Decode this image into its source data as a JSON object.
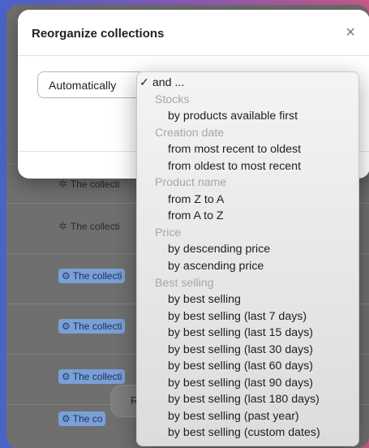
{
  "modal": {
    "title": "Reorganize collections",
    "close_glyph": "×",
    "sort_select": {
      "value": "Automatically",
      "chevron": "⇳"
    }
  },
  "background_list": {
    "rows": [
      {
        "text": "The collecti",
        "style": "plain"
      },
      {
        "text": "The collecti",
        "style": "plain"
      },
      {
        "text": "The collecti",
        "style": "chip"
      },
      {
        "text": "The collecti",
        "style": "chip"
      },
      {
        "text": "The collecti",
        "style": "chip"
      },
      {
        "text": "The co",
        "style": "chip"
      }
    ],
    "pill_label": "R"
  },
  "dropdown": {
    "items": [
      {
        "label": "✓ and ...",
        "type": "checked"
      },
      {
        "label": "Stocks",
        "type": "section"
      },
      {
        "label": "by products available first",
        "type": "option"
      },
      {
        "label": "Creation date",
        "type": "section"
      },
      {
        "label": "from most recent to oldest",
        "type": "option"
      },
      {
        "label": "from oldest to most recent",
        "type": "option"
      },
      {
        "label": "Product name",
        "type": "section"
      },
      {
        "label": "from Z to A",
        "type": "option"
      },
      {
        "label": "from A to Z",
        "type": "option"
      },
      {
        "label": "Price",
        "type": "section"
      },
      {
        "label": "by descending price",
        "type": "option"
      },
      {
        "label": "by ascending price",
        "type": "option"
      },
      {
        "label": "Best selling",
        "type": "section"
      },
      {
        "label": "by best selling",
        "type": "option"
      },
      {
        "label": "by best selling (last 7 days)",
        "type": "option"
      },
      {
        "label": "by best selling (last 15 days)",
        "type": "option"
      },
      {
        "label": "by best selling (last 30 days)",
        "type": "option"
      },
      {
        "label": "by best selling (last 60 days)",
        "type": "option"
      },
      {
        "label": "by best selling (last 90 days)",
        "type": "option"
      },
      {
        "label": "by best selling (last 180 days)",
        "type": "option"
      },
      {
        "label": "by best selling (past year)",
        "type": "option"
      },
      {
        "label": "by best selling (custom dates)",
        "type": "option"
      }
    ]
  }
}
